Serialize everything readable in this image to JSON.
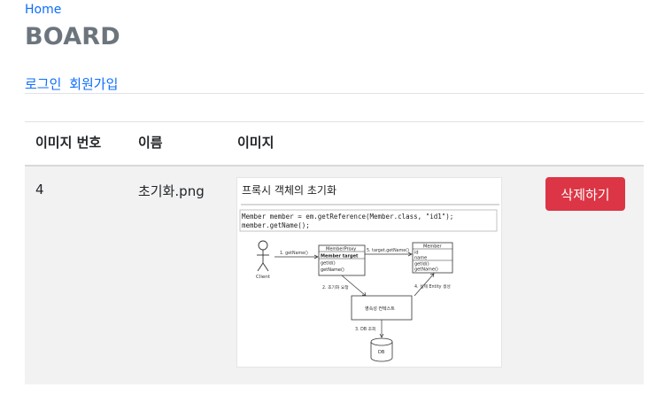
{
  "nav": {
    "home_label": "Home"
  },
  "page": {
    "title": "BOARD"
  },
  "auth": {
    "login_label": "로그인",
    "signup_label": "회원가입"
  },
  "table": {
    "headers": [
      "이미지 번호",
      "이름",
      "이미지"
    ],
    "rows": [
      {
        "id": "4",
        "name": "초기화.png",
        "delete_label": "삭제하기",
        "image": {
          "heading": "프록시 객체의 초기화",
          "code_line1": "Member member = em.getReference(Member.class, \"id1\");",
          "code_line2": "member.getName();",
          "client_label": "Client",
          "proxy_title": "MemberProxy",
          "proxy_field": "Member target",
          "proxy_method1": "getId()",
          "proxy_method2": "getName()",
          "member_title": "Member",
          "member_field1": "id",
          "member_field2": "name",
          "member_method1": "getId()",
          "member_method2": "getName()",
          "step1": "1. getName()",
          "step5": "5. target.getName()",
          "step2": "2. 초기화 요청",
          "step4": "4. 실제 Entity 생성",
          "context_label": "영속성 컨텍스트",
          "step3": "3. DB 조회",
          "db_label": "DB"
        }
      }
    ]
  },
  "colors": {
    "link": "#0d6efd",
    "danger": "#dc3545",
    "title": "#6c757d",
    "row_bg": "#f2f2f2"
  }
}
